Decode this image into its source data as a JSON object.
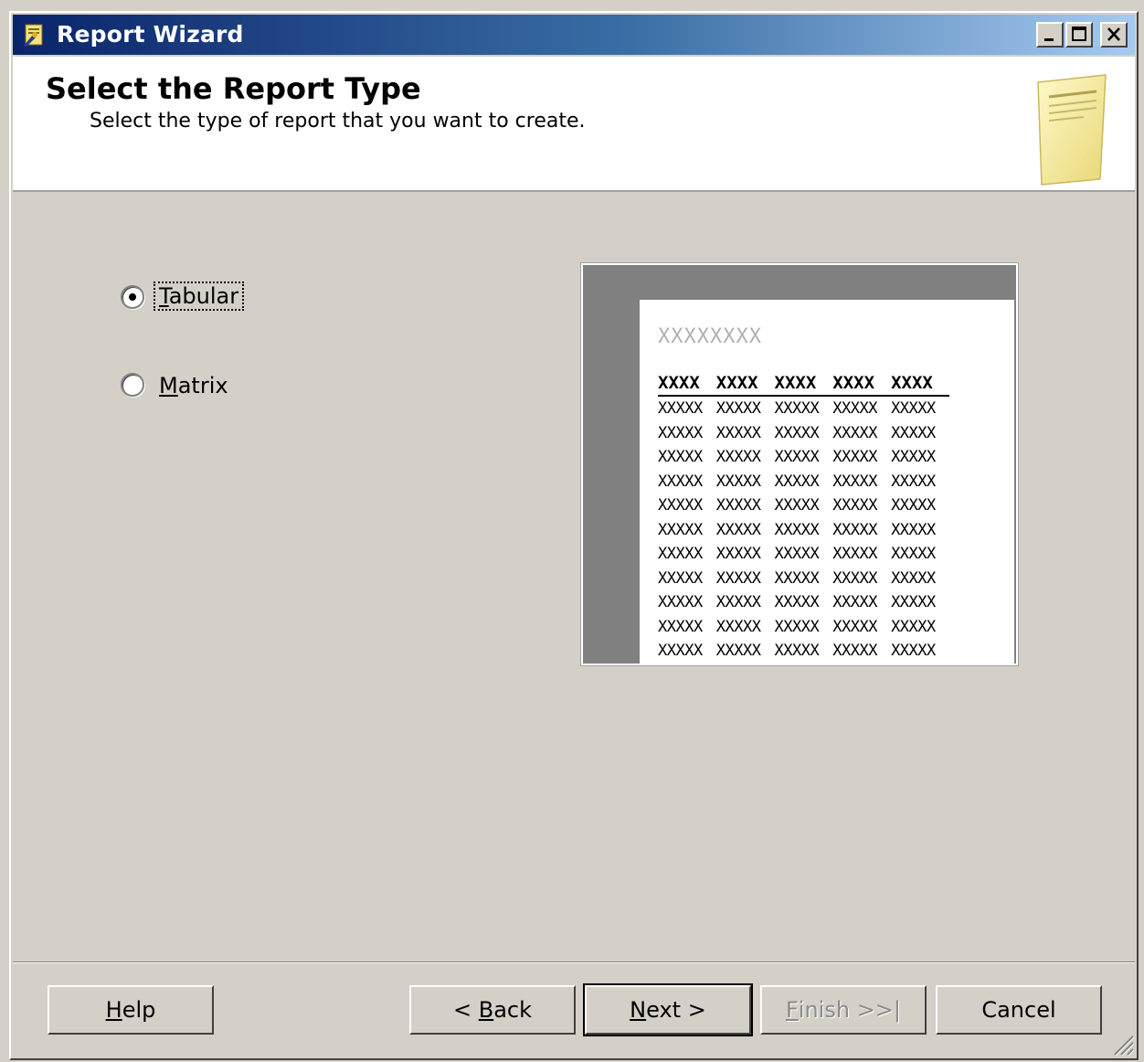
{
  "window": {
    "title": "Report Wizard",
    "minimize_glyph": "_",
    "maximize_glyph": "□",
    "close_glyph": "X"
  },
  "header": {
    "title": "Select the Report Type",
    "subtitle": "Select the type of report that you want to create."
  },
  "options": {
    "selected": "Tabular",
    "tabular": {
      "mnemonic": "T",
      "rest": "abular"
    },
    "matrix": {
      "mnemonic": "M",
      "rest": "atrix"
    }
  },
  "preview": {
    "title": "XXXXXXXX",
    "headers": [
      "XXXX",
      "XXXX",
      "XXXX",
      "XXXX",
      "XXXX"
    ],
    "rows": [
      [
        "XXXXX",
        "XXXXX",
        "XXXXX",
        "XXXXX",
        "XXXXX"
      ],
      [
        "XXXXX",
        "XXXXX",
        "XXXXX",
        "XXXXX",
        "XXXXX"
      ],
      [
        "XXXXX",
        "XXXXX",
        "XXXXX",
        "XXXXX",
        "XXXXX"
      ],
      [
        "XXXXX",
        "XXXXX",
        "XXXXX",
        "XXXXX",
        "XXXXX"
      ],
      [
        "XXXXX",
        "XXXXX",
        "XXXXX",
        "XXXXX",
        "XXXXX"
      ],
      [
        "XXXXX",
        "XXXXX",
        "XXXXX",
        "XXXXX",
        "XXXXX"
      ],
      [
        "XXXXX",
        "XXXXX",
        "XXXXX",
        "XXXXX",
        "XXXXX"
      ],
      [
        "XXXXX",
        "XXXXX",
        "XXXXX",
        "XXXXX",
        "XXXXX"
      ],
      [
        "XXXXX",
        "XXXXX",
        "XXXXX",
        "XXXXX",
        "XXXXX"
      ],
      [
        "XXXXX",
        "XXXXX",
        "XXXXX",
        "XXXXX",
        "XXXXX"
      ],
      [
        "XXXXX",
        "XXXXX",
        "XXXXX",
        "XXXXX",
        "XXXXX"
      ]
    ]
  },
  "buttons": {
    "help": {
      "mnemonic": "H",
      "rest": "elp"
    },
    "back": {
      "pre": "< ",
      "mnemonic": "B",
      "rest": "ack"
    },
    "next": {
      "mnemonic": "N",
      "rest": "ext >"
    },
    "finish": {
      "mnemonic": "F",
      "rest": "inish >>|",
      "enabled": false
    },
    "cancel": {
      "label": "Cancel"
    }
  },
  "colors": {
    "titlebar_start": "#0a246a",
    "titlebar_end": "#a6caf0",
    "dialog_face": "#d4d0c8",
    "header_bg": "#ffffff",
    "preview_frame": "#808080",
    "disabled_text": "#8a8a8a"
  },
  "icons": [
    "report-wizard-app-icon",
    "minimize-icon",
    "maximize-icon",
    "close-icon",
    "report-page-icon",
    "resize-grip-icon"
  ]
}
